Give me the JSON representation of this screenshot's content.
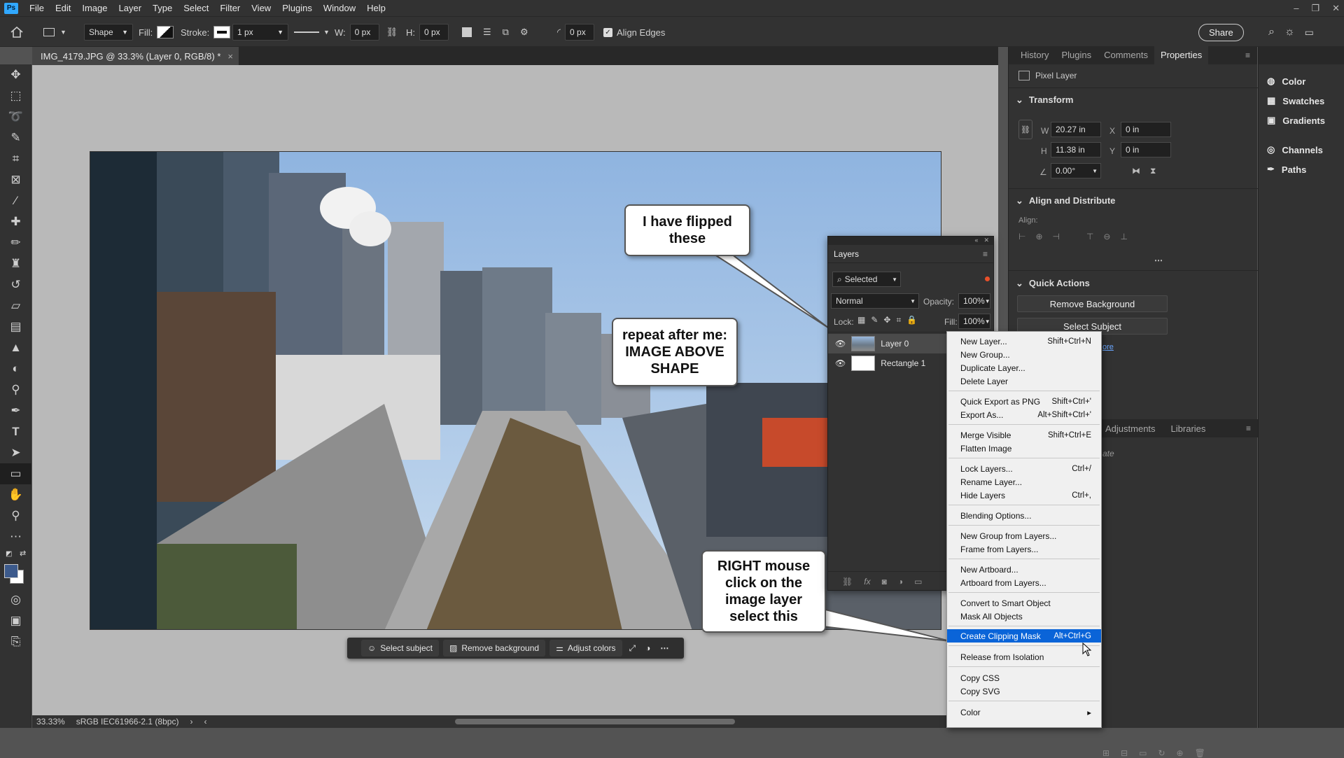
{
  "menubar": {
    "items": [
      "File",
      "Edit",
      "Image",
      "Layer",
      "Type",
      "Select",
      "Filter",
      "View",
      "Plugins",
      "Window",
      "Help"
    ],
    "logo": "Ps"
  },
  "options": {
    "mode": "Shape",
    "fill_label": "Fill:",
    "stroke_label": "Stroke:",
    "stroke_width": "1 px",
    "w_label": "W:",
    "w_value": "0 px",
    "h_label": "H:",
    "h_value": "0 px",
    "radius_value": "0 px",
    "align_edges": "Align Edges",
    "share": "Share"
  },
  "document": {
    "tab_title": "IMG_4179.JPG @ 33.3% (Layer 0, RGB/8) *",
    "zoom": "33.33%",
    "profile": "sRGB IEC61966-2.1 (8bpc)"
  },
  "callouts": {
    "flipped": "I have flipped these",
    "repeat": "repeat after me:  IMAGE ABOVE SHAPE",
    "rightclick": "RIGHT mouse click on the image layer select this"
  },
  "taskbar": {
    "select_subject": "Select subject",
    "remove_background": "Remove background",
    "adjust_colors": "Adjust colors"
  },
  "right_panel": {
    "tabs": [
      "History",
      "Plugins",
      "Comments",
      "Properties"
    ],
    "active_tab": "Properties",
    "layer_kind": "Pixel Layer",
    "transform": "Transform",
    "w_label": "W",
    "w_value": "20.27 in",
    "x_label": "X",
    "x_value": "0 in",
    "h_label": "H",
    "h_value": "11.38 in",
    "y_label": "Y",
    "y_value": "0 in",
    "angle": "0.00°",
    "align": "Align and Distribute",
    "align_label": "Align:",
    "quick_actions": "Quick Actions",
    "remove_bg": "Remove Background",
    "select_subject": "Select Subject",
    "more": "ore",
    "lower_tabs": [
      "Adjustments",
      "Libraries"
    ],
    "partial": "ate"
  },
  "right_column": {
    "items": [
      "Color",
      "Swatches",
      "Gradients",
      "Channels",
      "Paths"
    ]
  },
  "layers": {
    "title": "Layers",
    "filter": "Selected",
    "blend": "Normal",
    "opacity_label": "Opacity:",
    "opacity": "100%",
    "lock_label": "Lock:",
    "fill_label": "Fill:",
    "fill": "100%",
    "rows": [
      {
        "name": "Layer 0"
      },
      {
        "name": "Rectangle 1"
      }
    ]
  },
  "context_menu": {
    "items": [
      {
        "label": "New Layer...",
        "shortcut": "Shift+Ctrl+N"
      },
      {
        "label": "New Group...",
        "shortcut": ""
      },
      {
        "label": "Duplicate Layer...",
        "shortcut": ""
      },
      {
        "label": "Delete Layer",
        "shortcut": ""
      },
      {
        "label": "Quick Export as PNG",
        "shortcut": "Shift+Ctrl+'"
      },
      {
        "label": "Export As...",
        "shortcut": "Alt+Shift+Ctrl+'"
      },
      {
        "label": "Merge Visible",
        "shortcut": "Shift+Ctrl+E"
      },
      {
        "label": "Flatten Image",
        "shortcut": ""
      },
      {
        "label": "Lock Layers...",
        "shortcut": "Ctrl+/"
      },
      {
        "label": "Rename Layer...",
        "shortcut": ""
      },
      {
        "label": "Hide Layers",
        "shortcut": "Ctrl+,"
      },
      {
        "label": "Blending Options...",
        "shortcut": ""
      },
      {
        "label": "New Group from Layers...",
        "shortcut": ""
      },
      {
        "label": "Frame from Layers...",
        "shortcut": ""
      },
      {
        "label": "New Artboard...",
        "shortcut": ""
      },
      {
        "label": "Artboard from Layers...",
        "shortcut": ""
      },
      {
        "label": "Convert to Smart Object",
        "shortcut": ""
      },
      {
        "label": "Mask All Objects",
        "shortcut": ""
      },
      {
        "label": "Create Clipping Mask",
        "shortcut": "Alt+Ctrl+G"
      },
      {
        "label": "Release from Isolation",
        "shortcut": ""
      },
      {
        "label": "Copy CSS",
        "shortcut": ""
      },
      {
        "label": "Copy SVG",
        "shortcut": ""
      },
      {
        "label": "Color",
        "shortcut": ""
      }
    ]
  },
  "colors": {
    "highlight": "#0a64d8",
    "panel": "#323232",
    "canvas": "#b9b9b9"
  }
}
